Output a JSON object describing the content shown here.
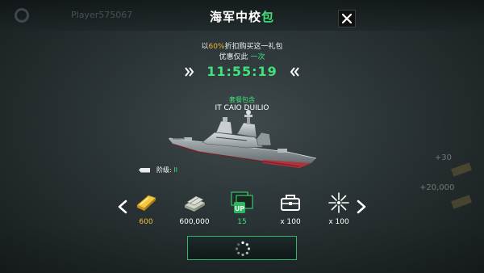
{
  "background": {
    "player_label": "Player575067",
    "side_values": [
      "+30",
      "+20,000"
    ]
  },
  "header": {
    "title_main": "海军中校",
    "title_accent": "包",
    "close_icon": "close-icon"
  },
  "offer": {
    "prefix": "以",
    "discount": "60%",
    "suffix": "折扣购买这一礼包",
    "limit_prefix": "优惠仅此",
    "limit_accent": "一次"
  },
  "timer": {
    "value": "11:55:19",
    "left_icon": "double-chevron-right-icon",
    "right_icon": "double-chevron-left-icon"
  },
  "package": {
    "label": "套餐包含",
    "ship_name": "IT CAIO DUILIO",
    "tier_label": "阶级:",
    "tier_value": "II"
  },
  "rewards": [
    {
      "icon": "gold-bar-icon",
      "qty": "600"
    },
    {
      "icon": "cash-stack-icon",
      "qty": "600,000"
    },
    {
      "icon": "upgrade-box-icon",
      "qty": "15"
    },
    {
      "icon": "toolbox-icon",
      "qty": "x 100"
    },
    {
      "icon": "starburst-icon",
      "qty": "x 100"
    }
  ],
  "colors": {
    "accent_green": "#3fe37a",
    "gold": "#f3c23a",
    "discount_orange": "#f3b13a"
  }
}
